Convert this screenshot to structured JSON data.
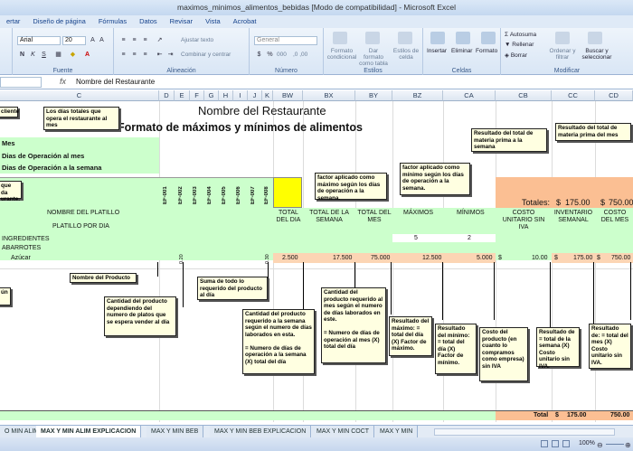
{
  "window": {
    "title": "maximos_minimos_alimentos_bebidas  [Modo de compatibilidad] - Microsoft Excel"
  },
  "menu_tabs": [
    "ertar",
    "Diseño de página",
    "Fórmulas",
    "Datos",
    "Revisar",
    "Vista",
    "Acrobat"
  ],
  "ribbon": {
    "font_name": "Arial",
    "font_size": "20",
    "font_group_label": "Fuente",
    "wrap_text": "Ajustar texto",
    "merge_center": "Combinar y centrar",
    "alignment_group_label": "Alineación",
    "number_format": "General",
    "number_group_label": "Número",
    "conditional_format": "Formato condicional",
    "format_as_table": "Dar formato como tabla",
    "cell_styles": "Estilos de celda",
    "styles_group_label": "Estilos",
    "insert": "Insertar",
    "delete": "Eliminar",
    "format": "Formato",
    "cells_group_label": "Celdas",
    "autosum": "Autosuma",
    "fill": "Rellenar",
    "clear": "Borrar",
    "sort_filter": "Ordenar y filtrar",
    "find_select": "Buscar y seleccionar",
    "modify_group_label": "Modificar",
    "bold": "N",
    "italic": "K",
    "underline": "S",
    "percent": "%",
    "thousands": "000"
  },
  "formula_bar": {
    "fx": "fx",
    "content": "Nombre del Restaurante"
  },
  "columns": [
    "C",
    "D",
    "E",
    "F",
    "G",
    "H",
    "I",
    "J",
    "K",
    "BW",
    "BX",
    "BY",
    "BZ",
    "CA",
    "CB",
    "CC",
    "CD"
  ],
  "sheet": {
    "restaurant_name": "Nombre del Restaurante",
    "format_title": "Formato de  máximos y mínimos de alimentos",
    "label_mes": "Mes",
    "label_dias_mes": "Dias de Operación al mes",
    "label_dias_semana": "Dias de Operación a la semana",
    "totales_label": "Totales:",
    "totales_cur1": "$",
    "totales_val1": "175.00",
    "totales_cur2": "$",
    "totales_val2": "750.00",
    "header_nombre": "NOMBRE DEL PLATILLO",
    "header_platillo_dia": "PLATILLO POR DIA",
    "header_ingredientes": "INGREDIENTES",
    "header_abarrotes": "ABARROTES",
    "ef_codes": [
      "EF-001",
      "EF-002",
      "EF-003",
      "EF-004",
      "EF-005",
      "EF-006",
      "EF-007",
      "EF-008"
    ],
    "h_total_dia": "TOTAL DEL DIA",
    "h_total_semana": "TOTAL DE LA SEMANA",
    "h_total_mes": "TOTAL DEL MES",
    "h_maximos": "MÁXIMOS",
    "h_minimos": "MÍNIMOS",
    "h_costo": "COSTO UNITARIO SIN IVA",
    "h_inv_semanal": "INVENTARIO SEMANAL",
    "h_costo_mes": "COSTO DEL MES",
    "factor_max": "5",
    "factor_min": "2",
    "item_name": "Azúcar",
    "item_qty_e": "0.20",
    "item_qty_k": "0.30",
    "v_total_dia": "2.500",
    "v_total_semana": "17.500",
    "v_total_mes": "75.000",
    "v_max": "12.500",
    "v_min": "5.000",
    "v_costo_cur": "$",
    "v_costo": "10.00",
    "v_inv_cur": "$",
    "v_inv": "175.00",
    "v_mes_cur": "$",
    "v_mes": "750.00",
    "total_label": "Total",
    "total_cur": "$",
    "total_val": "175.00",
    "total_val2": "750.00"
  },
  "notes": {
    "n_cliente": "cliente",
    "n_dias_totales": "Los días  totales que opera el restaurante al mes",
    "n_que_da": "que da urante.",
    "n_nombre_producto": "Nombre del Producto",
    "n_un": "ún",
    "n_cantidad_producto": "Cantidad del producto dependiendo del numero de platos que se espera vender al día",
    "n_suma": "Suma de todo lo requerido del producto al día",
    "n_cant_semana": "Cantidad del producto requerido a la semana según el numero de días laborados en esta.\n\n= Numero de días de operación a la semana (X) total del día",
    "n_cant_mes": "Cantidad del producto requerido al mes según el numero de días laborados en este.\n\n= Numero de días de operación al mes (X) total del día",
    "n_factor_max": "factor aplicado como máximo  según los días de operación a la semana.",
    "n_factor_min": "factor aplicado como mínimo  según los días de operación a la semana.",
    "n_res_max": "Resultado del máximo: = total del día (X) Factor de máximo.",
    "n_res_min": "Resultado del mínimo: = total del día (X) Factor de mínimo.",
    "n_costo_prod": "Costo del producto (en cuanto lo compramos como empresa) sin IVA",
    "n_res_semana": "Resultado de = total de la semana (X) Costo unitario sin IVA.",
    "n_res_mes": "Resultado de: = total del mes  (X) Costo unitario sin IVA.",
    "n_total_mp_semana": "Resultado del total de materia prima a la semana",
    "n_total_mp_mes": "Resultado del total de materia prima del mes"
  },
  "sheet_tabs": [
    "O MIN ALIM",
    "MAX Y MIN ALIM  EXPLICACION",
    "MAX Y MIN BEB",
    "MAX Y MIN BEB EXPLICACION",
    "MAX Y MIN COCT",
    "MAX Y MIN"
  ],
  "status": {
    "zoom": "100%"
  },
  "colors": {
    "green_fill": "#ccffcc",
    "yellow_fill": "#ffff00",
    "orange_fill": "#fcd5b4",
    "peach_fill": "#fbbf93",
    "note_fill": "#ffffe1"
  }
}
